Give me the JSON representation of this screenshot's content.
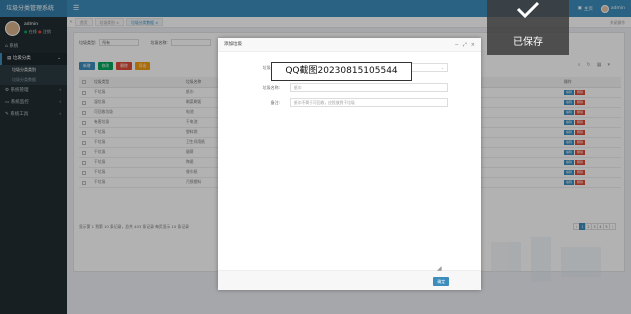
{
  "app": {
    "title": "垃圾分类管理系统"
  },
  "header": {
    "menu_icon": "hamburger-icon",
    "items": [
      {
        "icon": "bell-icon",
        "label": "主页"
      },
      {
        "icon": "user-icon",
        "label": "admin"
      }
    ]
  },
  "sidebar": {
    "user": {
      "name": "admin",
      "status": "在线",
      "extra": "注销"
    },
    "items": [
      {
        "label": "系统",
        "icon": "home-icon"
      },
      {
        "label": "垃圾分类",
        "icon": "trash-icon",
        "active": true
      },
      {
        "label": "系统管理",
        "icon": "gear-icon"
      },
      {
        "label": "系统监控",
        "icon": "monitor-icon"
      },
      {
        "label": "系统工具",
        "icon": "tool-icon"
      }
    ],
    "subitems": [
      {
        "label": "垃圾分类类别",
        "current": true
      },
      {
        "label": "垃圾分类数据",
        "current": false
      }
    ]
  },
  "tabs": {
    "items": [
      {
        "label": "首页"
      },
      {
        "label": "垃圾类别 ×"
      },
      {
        "label": "垃圾分类数据 ×",
        "active": true
      }
    ],
    "close_label": "关闭操作"
  },
  "search": {
    "type_label": "垃圾类型:",
    "type_value": "所有",
    "name_label": "垃圾名称:"
  },
  "toolbar": {
    "add": "新增",
    "edit": "修改",
    "delete": "删除",
    "export": "导出"
  },
  "table": {
    "headers": [
      "垃圾类型",
      "垃圾名称",
      "备注",
      "操作"
    ],
    "rows": [
      {
        "type": "干垃圾",
        "name": "纸巾"
      },
      {
        "type": "湿垃圾",
        "name": "剩菜剩饭"
      },
      {
        "type": "可回收垃圾",
        "name": "电池"
      },
      {
        "type": "有害垃圾",
        "name": "干电池"
      },
      {
        "type": "干垃圾",
        "name": "塑料袋"
      },
      {
        "type": "干垃圾",
        "name": "卫生间用纸"
      },
      {
        "type": "干垃圾",
        "name": "烟蒂"
      },
      {
        "type": "干垃圾",
        "name": "陶瓷"
      },
      {
        "type": "干垃圾",
        "name": "餐巾纸"
      },
      {
        "type": "干垃圾",
        "name": "污损塑料"
      }
    ],
    "row_actions": {
      "edit": "编辑",
      "delete": "删除"
    }
  },
  "pagination": {
    "summary": "显示第 1 到第 10 条记录，总共 403 条记录 每页显示 10 条记录",
    "pages": [
      "‹",
      "1",
      "2",
      "3",
      "4",
      "5",
      "›"
    ]
  },
  "modal": {
    "title": "添加垃圾",
    "controls": [
      "minimize-icon",
      "maximize-icon",
      "close-icon"
    ],
    "fields": [
      {
        "label": "垃圾类型:",
        "value": "",
        "type": "select"
      },
      {
        "label": "垃圾名称:",
        "value": "纸巾"
      },
      {
        "label": "备注:",
        "value": "纸巾不属于可回收，应投放到干垃圾"
      }
    ],
    "confirm": "确定"
  },
  "screenshot_tip": "QQ截图20230815105544",
  "toast": {
    "text": "已保存",
    "icon": "check-icon"
  },
  "colors": {
    "primary": "#3c8dbc",
    "sidebar": "#222d32",
    "success": "#00a65a",
    "danger": "#dd4b39",
    "warning": "#f39c12"
  }
}
